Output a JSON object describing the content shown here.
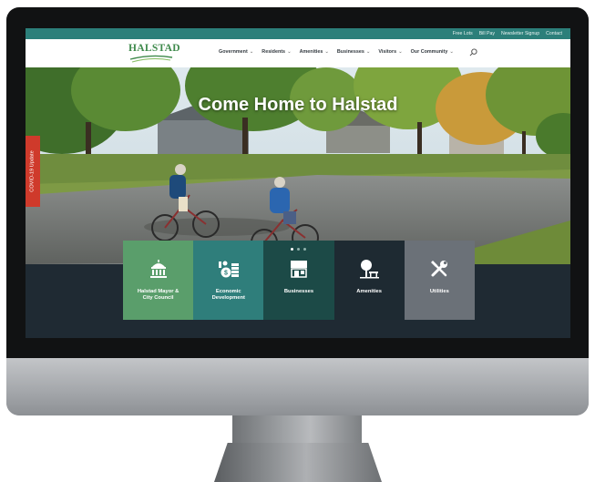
{
  "site": {
    "logo_text": "HALSTAD",
    "hero_title": "Come Home to Halstad",
    "covid_tab": "COVID-19 Update"
  },
  "topbar": {
    "links": [
      "Free Lots",
      "Bill Pay",
      "Newsletter Signup",
      "Contact"
    ]
  },
  "nav": {
    "items": [
      "Government",
      "Residents",
      "Amenities",
      "Businesses",
      "Visitors",
      "Our Community"
    ],
    "chevron": "⌄"
  },
  "tiles": [
    {
      "label": "Halstad Mayor &\nCity Council",
      "icon": "capitol-building-icon",
      "color": "#5a9e6b"
    },
    {
      "label": "Economic\nDevelopment",
      "icon": "money-growth-icon",
      "color": "#2f7e7b"
    },
    {
      "label": "Businesses",
      "icon": "storefront-icon",
      "color": "#1c4a47"
    },
    {
      "label": "Amenities",
      "icon": "tree-bench-icon",
      "color": "#1e2a32"
    },
    {
      "label": "Utilities",
      "icon": "tools-icon",
      "color": "#6b7178"
    }
  ],
  "colors": {
    "topbar": "#2c7f7a",
    "covid": "#cf3a2b",
    "logo": "#3f8a4c"
  }
}
